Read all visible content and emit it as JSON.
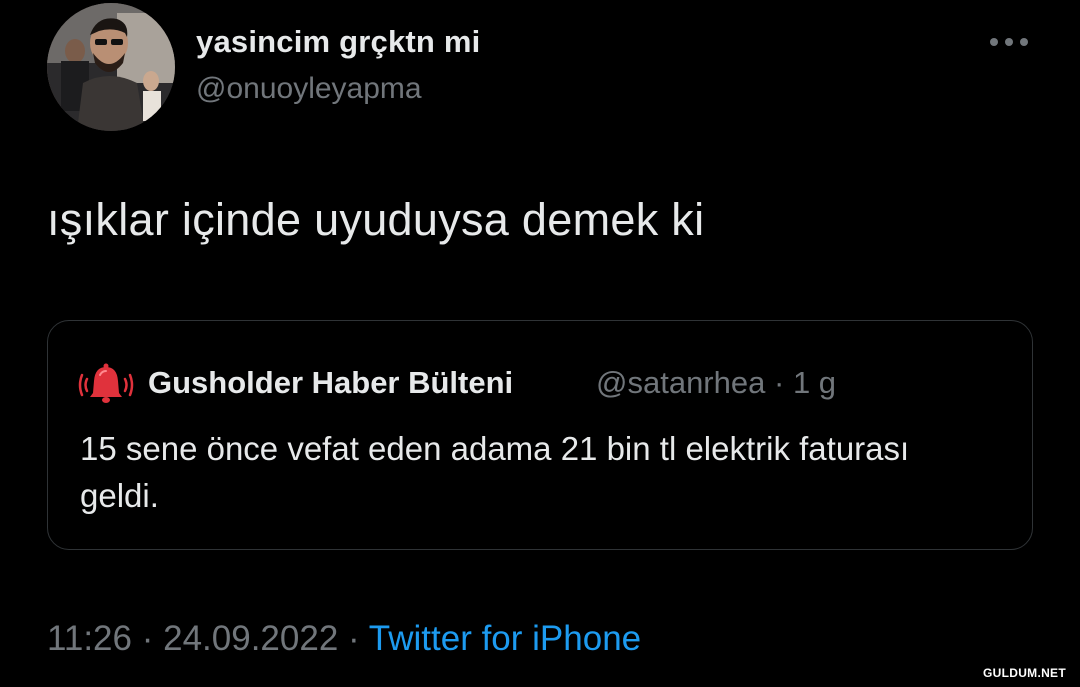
{
  "tweet": {
    "author": {
      "display_name": "yasincim grçktn mi",
      "handle": "@onuoyleyapma"
    },
    "text": "ışıklar içinde uyuduysa demek ki",
    "more_icon": "more-horizontal-icon",
    "quoted": {
      "avatar_icon": "bell-alarm-icon",
      "display_name": "Gusholder Haber Bülteni",
      "handle": "@satanrhea",
      "separator": "·",
      "age": "1 g",
      "text": "15 sene önce vefat eden adama 21 bin tl elektrik faturası geldi."
    },
    "footer": {
      "time": "11:26",
      "separator": "·",
      "date": "24.09.2022",
      "source": "Twitter for iPhone"
    }
  },
  "watermark": "GULDUM.NET",
  "colors": {
    "background": "#000000",
    "primary_text": "#e7e9ea",
    "secondary_text": "#71767b",
    "link": "#1d9bf0",
    "border": "#2f3336",
    "alert_red": "#e0323c"
  }
}
